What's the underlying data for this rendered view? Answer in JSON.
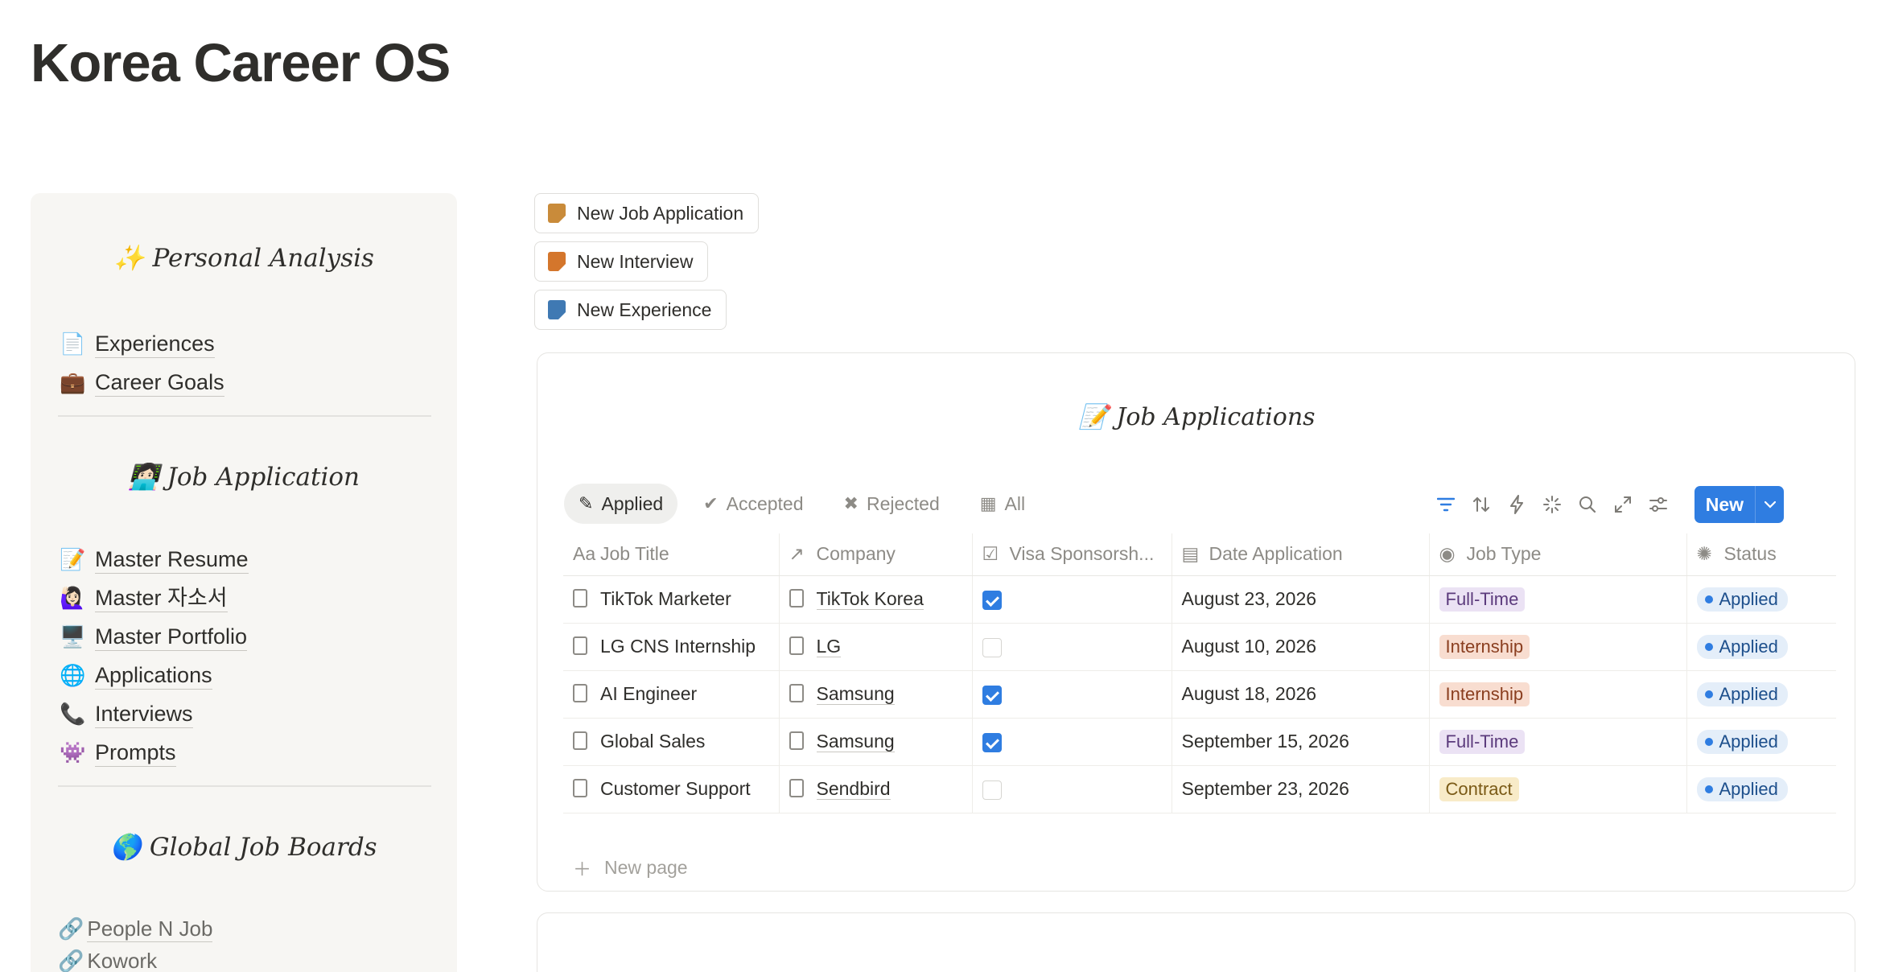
{
  "page": {
    "title": "Korea Career OS"
  },
  "sidebar": {
    "personal_heading": "✨ Personal Analysis",
    "personal_items": [
      {
        "emoji": "📄",
        "label": "Experiences"
      },
      {
        "emoji": "💼",
        "label": "Career Goals"
      }
    ],
    "job_heading": "👩🏻‍💻 Job Application",
    "job_items": [
      {
        "emoji": "📝",
        "label": "Master Resume"
      },
      {
        "emoji": "🙋🏻‍♀️",
        "label": "Master 자소서"
      },
      {
        "emoji": "🖥️",
        "label": "Master Portfolio"
      },
      {
        "emoji": "🌐",
        "label": "Applications"
      },
      {
        "emoji": "📞",
        "label": "Interviews"
      },
      {
        "emoji": "👾",
        "label": "Prompts"
      }
    ],
    "boards_heading": "🌎 Global Job Boards",
    "board_links": [
      {
        "emoji": "🔗",
        "label": "People N Job"
      },
      {
        "emoji": "🔗",
        "label": "Kowork"
      }
    ]
  },
  "buttons": [
    {
      "label": "New Job Application",
      "color": "#c98b3a"
    },
    {
      "label": "New Interview",
      "color": "#d4762c"
    },
    {
      "label": "New Experience",
      "color": "#3f79b3"
    }
  ],
  "database": {
    "title": "📝 Job Applications",
    "views": [
      {
        "icon": "✎",
        "label": "Applied"
      },
      {
        "icon": "✔",
        "label": "Accepted"
      },
      {
        "icon": "✖",
        "label": "Rejected"
      },
      {
        "icon": "▦",
        "label": "All"
      }
    ],
    "new_label": "New",
    "columns": [
      {
        "icon": "Aa",
        "label": "Job Title"
      },
      {
        "icon": "↗",
        "label": "Company"
      },
      {
        "icon": "☑",
        "label": "Visa Sponsorsh..."
      },
      {
        "icon": "▤",
        "label": "Date Application"
      },
      {
        "icon": "◉",
        "label": "Job Type"
      },
      {
        "icon": "✺",
        "label": "Status"
      }
    ],
    "rows": [
      {
        "title": "TikTok Marketer",
        "company": "TikTok Korea",
        "visa": true,
        "date": "August 23, 2026",
        "type": "Full-Time",
        "status": "Applied"
      },
      {
        "title": "LG CNS Internship",
        "company": "LG",
        "visa": false,
        "date": "August 10, 2026",
        "type": "Internship",
        "status": "Applied"
      },
      {
        "title": "AI Engineer",
        "company": "Samsung",
        "visa": true,
        "date": "August 18, 2026",
        "type": "Internship",
        "status": "Applied"
      },
      {
        "title": "Global Sales",
        "company": "Samsung",
        "visa": true,
        "date": "September 15, 2026",
        "type": "Full-Time",
        "status": "Applied"
      },
      {
        "title": "Customer Support",
        "company": "Sendbird",
        "visa": false,
        "date": "September 23, 2026",
        "type": "Contract",
        "status": "Applied"
      }
    ],
    "type_colors": {
      "Full-Time": {
        "bg": "#ebe2f4",
        "fg": "#5b3a7c"
      },
      "Internship": {
        "bg": "#f8ddd0",
        "fg": "#8a3e1f"
      },
      "Contract": {
        "bg": "#f8ebc8",
        "fg": "#7a5a16"
      }
    },
    "new_page_label": "New page"
  }
}
